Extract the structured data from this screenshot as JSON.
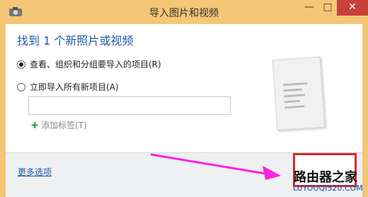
{
  "window": {
    "title": "导入图片和视频",
    "minimize_glyph": "—",
    "maximize_glyph": "□",
    "close_glyph": "✕"
  },
  "content": {
    "heading": "找到 1 个新照片或视频",
    "option1_label": "查看、组织和分组要导入的项目(R)",
    "option1_selected": true,
    "option2_label": "立即导入所有新项目(A)",
    "option2_selected": false,
    "tag_input_value": "",
    "tag_input_placeholder": "",
    "add_tag_label": "添加标签(T)"
  },
  "bottom": {
    "more_options_link": "更多选项",
    "import_button_label": ""
  },
  "watermark": {
    "logo_text": "路由器之家",
    "url_text": "LUYOUQI520.COM"
  },
  "colors": {
    "accent": "#1f5aa6",
    "arrow": "#ff22dd",
    "highlight_box": "#d62a2a",
    "frame": "#f4c676"
  }
}
